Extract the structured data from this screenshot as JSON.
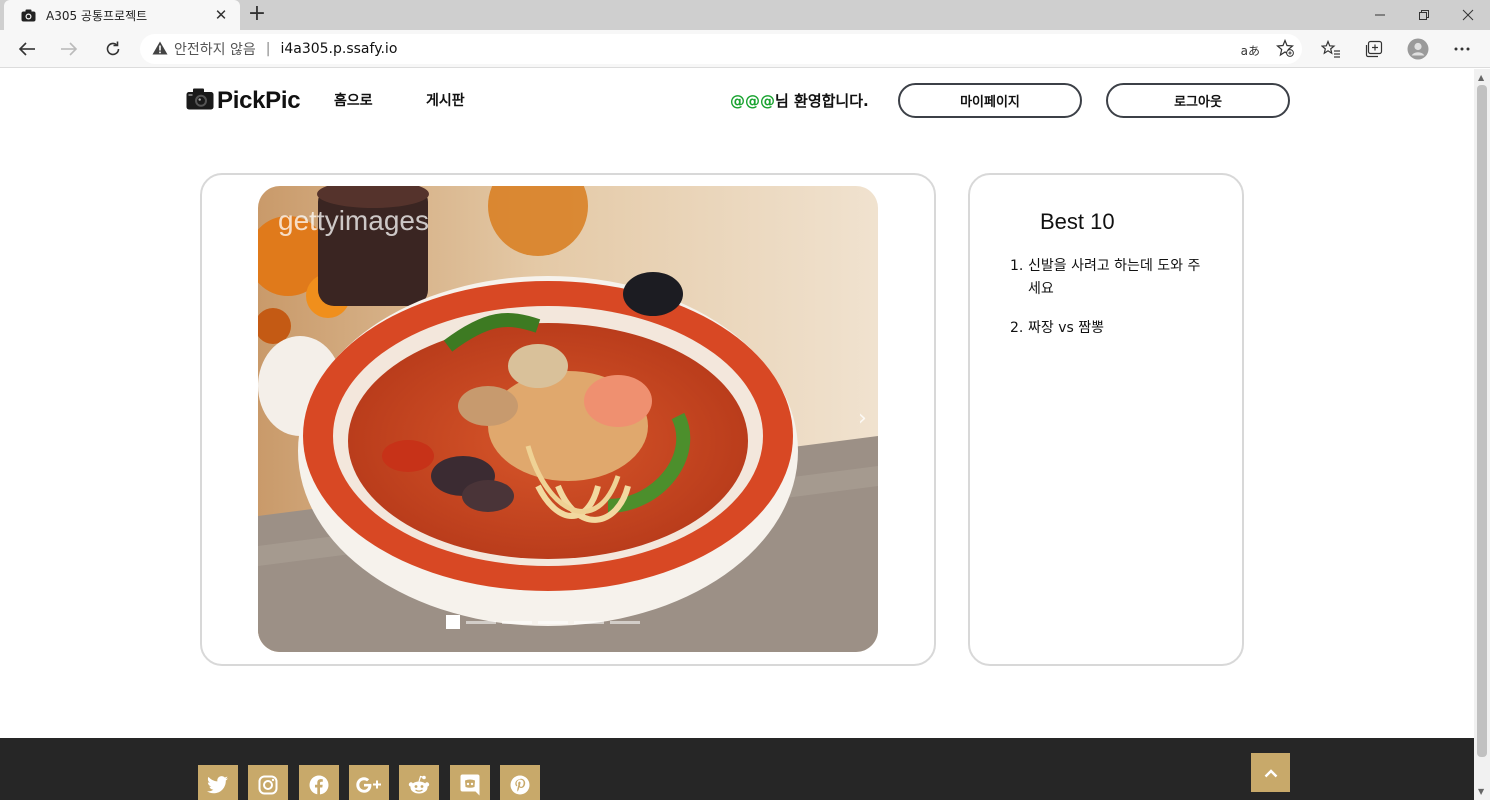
{
  "browser": {
    "tab_title": "A305 공통프로젝트",
    "tab_icon": "camera-icon",
    "security_label": "안전하지 않음",
    "separator": "|",
    "url": "i4a305.p.ssafy.io",
    "read_aloud_label": "aあ"
  },
  "site": {
    "logo_text": "PickPic",
    "nav": {
      "home": "홈으로",
      "board": "게시판"
    },
    "welcome_user": "@@@",
    "welcome_suffix": "님 환영합니다.",
    "mypage_label": "마이페이지",
    "logout_label": "로그아웃"
  },
  "carousel": {
    "slide_count": 6,
    "active_index": 0,
    "watermark": "gettyimages"
  },
  "best": {
    "title": "Best 10",
    "items": [
      {
        "num": "1.",
        "text": "신발을 사려고 하는데 도와 주세요"
      },
      {
        "num": "2.",
        "text": "짜장 vs 짬뽕"
      }
    ]
  },
  "footer": {
    "social_icons": [
      "twitter-icon",
      "instagram-icon",
      "facebook-icon",
      "google-plus-icon",
      "reddit-icon",
      "discord-icon",
      "pinterest-icon"
    ]
  },
  "colors": {
    "accent": "#c8a96a",
    "footer_bg": "#262626",
    "username": "#17a22e",
    "border": "#d8d8d8"
  }
}
